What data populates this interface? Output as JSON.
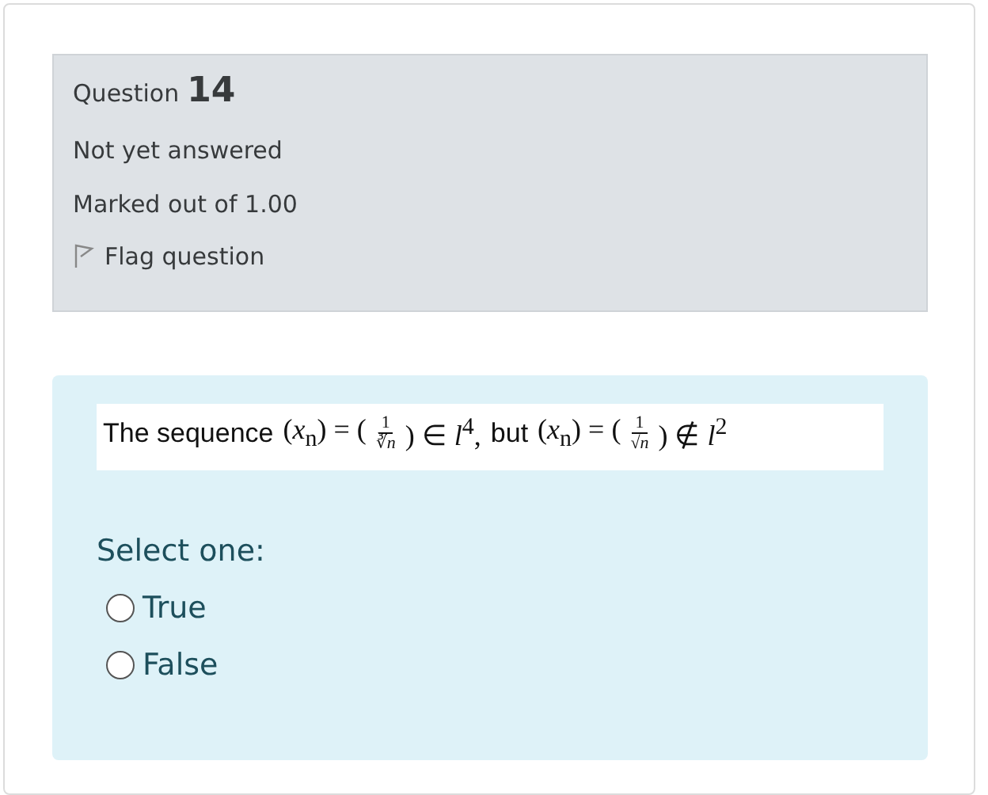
{
  "info": {
    "label": "Question",
    "number": "14",
    "state": "Not yet answered",
    "grade": "Marked out of 1.00",
    "flag": {
      "label": "Flag question",
      "flagged": false
    }
  },
  "question": {
    "parts": [
      {
        "kind": "text",
        "text": "The sequence"
      },
      {
        "kind": "math",
        "text": "(*x*$_{n}$) = ("
      },
      {
        "kind": "frac",
        "num": "1",
        "den": "∛*n*"
      },
      {
        "kind": "math",
        "text": ") ∈ *l*$^{4}$,"
      },
      {
        "kind": "text",
        "text": "but"
      },
      {
        "kind": "math",
        "text": "(*x*$_{n}$) = ("
      },
      {
        "kind": "frac",
        "num": "1",
        "den": "√*n*"
      },
      {
        "kind": "math",
        "text": ") ∉ *l*$^{2}$"
      }
    ]
  },
  "prompt": "Select one:",
  "options": [
    {
      "label": "True",
      "selected": false
    },
    {
      "label": "False",
      "selected": false
    }
  ]
}
